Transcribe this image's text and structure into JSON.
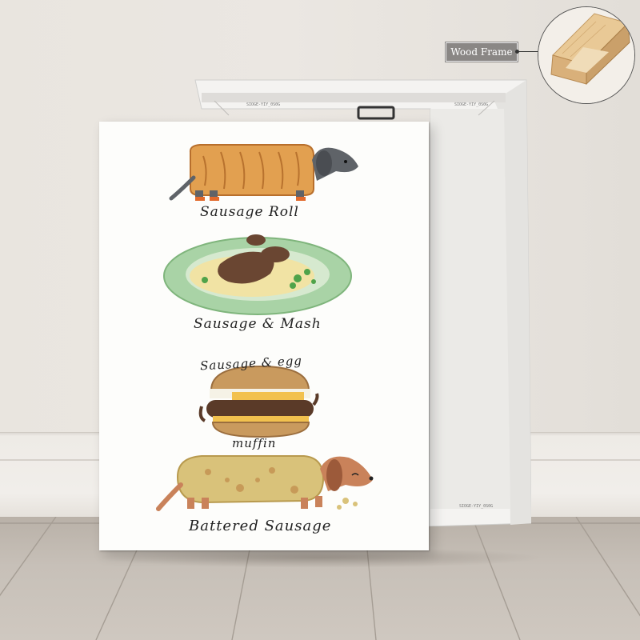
{
  "callout": {
    "label": "Wood Frame"
  },
  "zoom_inset": {
    "depicts": "wood-frame-corner"
  },
  "print": {
    "items": [
      {
        "key": "roll",
        "label": "Sausage Roll"
      },
      {
        "key": "mash",
        "label": "Sausage & Mash"
      },
      {
        "key": "egg",
        "label": "Sausage & egg"
      },
      {
        "key": "muffin",
        "label": "muffin"
      },
      {
        "key": "battered",
        "label": "Battered Sausage"
      }
    ]
  },
  "colors": {
    "wall": "#e9e5df",
    "floor": "#c7c0b8",
    "pastry": "#e2a050",
    "plate": "#a9d3a6",
    "dog": "#5f6368",
    "batter": "#d9c27a",
    "muffin": "#c99a5e",
    "sausage": "#5a3a28",
    "dachshund": "#c9825a",
    "wood": "#e1bd8a"
  }
}
